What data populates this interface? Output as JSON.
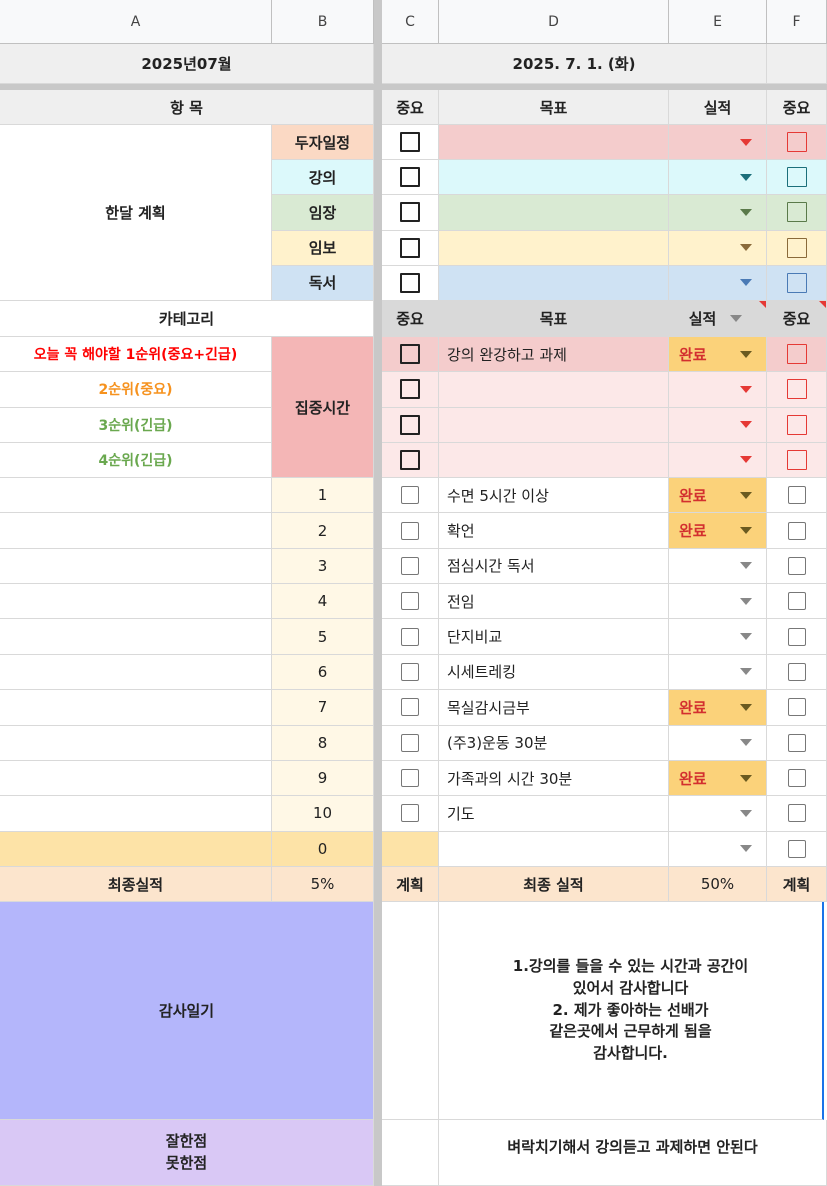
{
  "columns": [
    "A",
    "B",
    "C",
    "D",
    "E",
    "F"
  ],
  "row1": {
    "month": "2025년07월",
    "date": "2025. 7. 1. (화)"
  },
  "header": {
    "item": "항 목",
    "important": "중요",
    "goal": "목표",
    "result": "실적"
  },
  "monthly": {
    "label": "한달 계획",
    "rows": [
      {
        "name": "두자일정",
        "color": "#fbd9c4",
        "tint": "#f4cccc",
        "accent": "red"
      },
      {
        "name": "강의",
        "color": "#dcf9fb",
        "tint": "#dcf9fb",
        "accent": "teal"
      },
      {
        "name": "임장",
        "color": "#d9ead3",
        "tint": "#d9ead3",
        "accent": "green"
      },
      {
        "name": "임보",
        "color": "#fff2cc",
        "tint": "#fff2cc",
        "accent": "brown"
      },
      {
        "name": "독서",
        "color": "#cfe2f3",
        "tint": "#cfe2f3",
        "accent": "blue"
      }
    ]
  },
  "category": {
    "label": "카테고리",
    "priorities": [
      {
        "text": "오늘 꼭 해야할 1순위(중요+긴급)",
        "color": "#ff0000"
      },
      {
        "text": "2순위(중요)",
        "color": "#f6921e"
      },
      {
        "text": "3순위(긴급)",
        "color": "#6aa84f"
      },
      {
        "text": "4순위(긴급)",
        "color": "#6aa84f"
      }
    ],
    "focus_label": "집중시간",
    "focus_goals": [
      "강의 완강하고 과제",
      "",
      "",
      ""
    ],
    "focus_results": [
      "완료",
      "",
      "",
      ""
    ]
  },
  "tasks": [
    {
      "num": "1",
      "goal": "수면 5시간 이상",
      "result": "완료"
    },
    {
      "num": "2",
      "goal": "확언",
      "result": "완료"
    },
    {
      "num": "3",
      "goal": "점심시간 독서",
      "result": ""
    },
    {
      "num": "4",
      "goal": "전임",
      "result": ""
    },
    {
      "num": "5",
      "goal": "단지비교",
      "result": ""
    },
    {
      "num": "6",
      "goal": "시세트레킹",
      "result": ""
    },
    {
      "num": "7",
      "goal": "목실감시금부",
      "result": "완료"
    },
    {
      "num": "8",
      "goal": "(주3)운동 30분",
      "result": ""
    },
    {
      "num": "9",
      "goal": "가족과의 시간 30분",
      "result": "완료"
    },
    {
      "num": "10",
      "goal": "기도",
      "result": ""
    },
    {
      "num": "0",
      "goal": "",
      "result": ""
    }
  ],
  "summary": {
    "final_label": "최종실적",
    "final_value": "5%",
    "plan": "계획",
    "final_label2": "최종 실적",
    "final_value2": "50%",
    "plan2": "계획"
  },
  "gratitude": {
    "label": "감사일기",
    "lines": [
      "1.강의를 들을 수 있는 시간과 공간이",
      "있어서 감사합니다",
      "2. 제가 좋아하는 선배가",
      "같은곳에서 근무하게 됨을",
      "감사합니다."
    ]
  },
  "review": {
    "label1": "잘한점",
    "label2": "못한점",
    "text": "벼락치기해서 강의듣고 과제하면 안된다"
  }
}
